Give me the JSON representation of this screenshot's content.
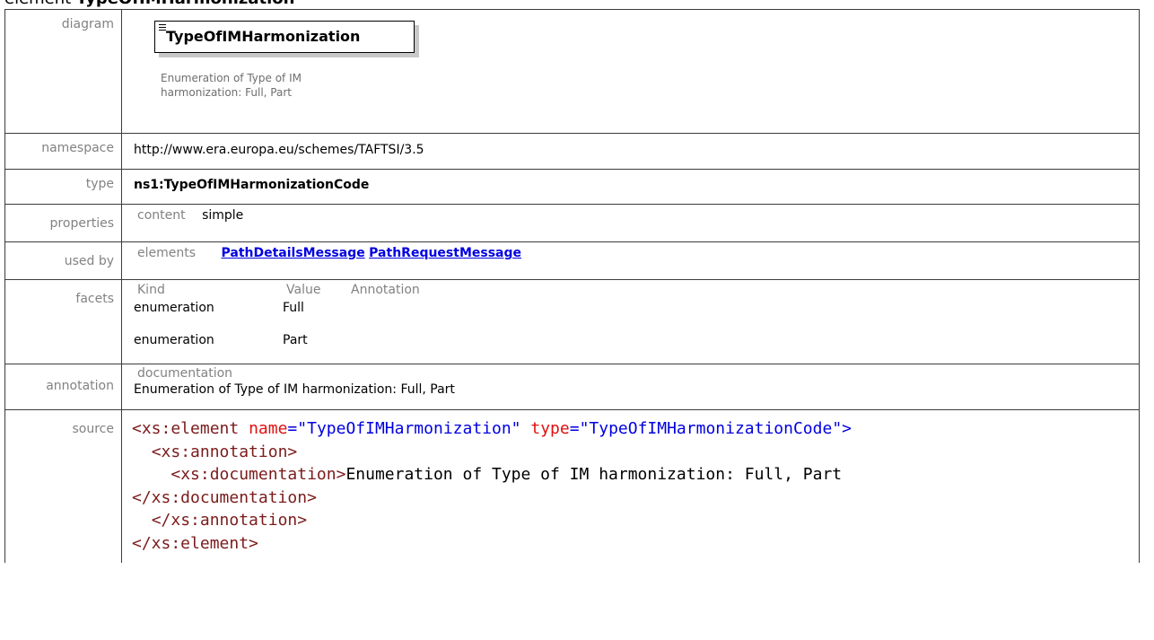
{
  "heading": {
    "prefix": "element ",
    "name": "TypeOfIMHarmonization"
  },
  "rows": {
    "diagram": {
      "label": "diagram",
      "element_name": "TypeOfIMHarmonization",
      "note": "Enumeration of Type of IM harmonization: Full, Part"
    },
    "namespace": {
      "label": "namespace",
      "value": "http://www.era.europa.eu/schemes/TAFTSI/3.5"
    },
    "type": {
      "label": "type",
      "value": "ns1:TypeOfIMHarmonizationCode"
    },
    "properties": {
      "label": "properties",
      "key": "content",
      "value": "simple"
    },
    "used_by": {
      "label": "used by",
      "key": "elements",
      "links": [
        "PathDetailsMessage",
        "PathRequestMessage"
      ]
    },
    "facets": {
      "label": "facets",
      "headers": [
        "Kind",
        "Value",
        "Annotation"
      ],
      "items": [
        {
          "kind": "enumeration",
          "value": "Full"
        },
        {
          "kind": "enumeration",
          "value": "Part"
        }
      ]
    },
    "annotation": {
      "label": "annotation",
      "key": "documentation",
      "value": "Enumeration of Type of IM harmonization: Full, Part"
    },
    "source": {
      "label": "source",
      "code": {
        "open_tag": "<xs:element",
        "name_attr": "name",
        "name_val": "\"TypeOfIMHarmonization\"",
        "type_attr": "type",
        "type_val": "\"TypeOfIMHarmonizationCode\"",
        "close_bracket": ">",
        "annotation_open": "<xs:annotation>",
        "doc_open": "<xs:documentation>",
        "doc_text": "Enumeration of Type of IM harmonization: Full, Part",
        "doc_close": "</xs:documentation>",
        "annotation_close": "</xs:annotation>",
        "element_close": "</xs:element>"
      }
    }
  },
  "colors": {
    "label": "#828282",
    "link": "#0000e0",
    "tag": "#7b1b1b",
    "attr": "#e01010",
    "border": "#3c3c3c"
  }
}
